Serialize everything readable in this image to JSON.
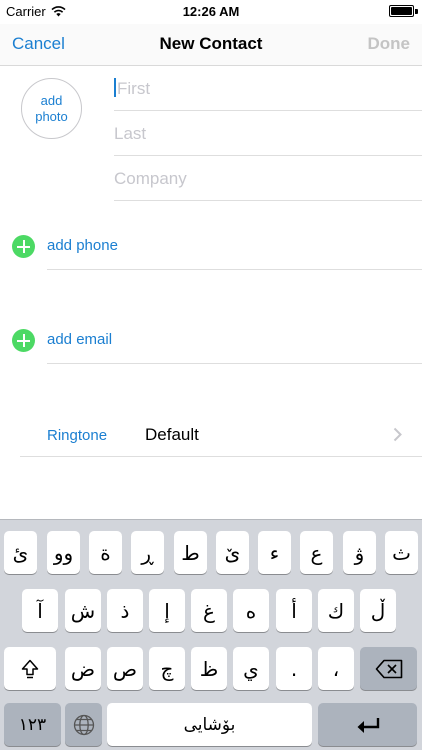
{
  "status_bar": {
    "carrier": "Carrier",
    "time": "12:26 AM"
  },
  "nav": {
    "cancel": "Cancel",
    "title": "New Contact",
    "done": "Done"
  },
  "photo": {
    "label_line1": "add",
    "label_line2": "photo"
  },
  "fields": {
    "first_placeholder": "First",
    "last_placeholder": "Last",
    "company_placeholder": "Company"
  },
  "add_phone": "add phone",
  "add_email": "add email",
  "ringtone": {
    "label": "Ringtone",
    "value": "Default"
  },
  "keyboard": {
    "row1": [
      "ث",
      "ۋ",
      "ع",
      "ء",
      "ێ",
      "ط",
      "ڕ",
      "ة",
      "وو",
      "ئ"
    ],
    "row2": [
      "ڵ",
      "ك",
      "أ",
      "ه",
      "غ",
      "إ",
      "ذ",
      "ش",
      "آ"
    ],
    "row3": [
      "،",
      ".",
      "ي",
      "ظ",
      "چ",
      "ص",
      "ض"
    ],
    "numbers": "١٢٣",
    "space": "بۆشایی"
  },
  "colors": {
    "accent": "#1b7fd1",
    "add_green": "#4cd964",
    "keyboard_bg": "#d2d5db"
  }
}
